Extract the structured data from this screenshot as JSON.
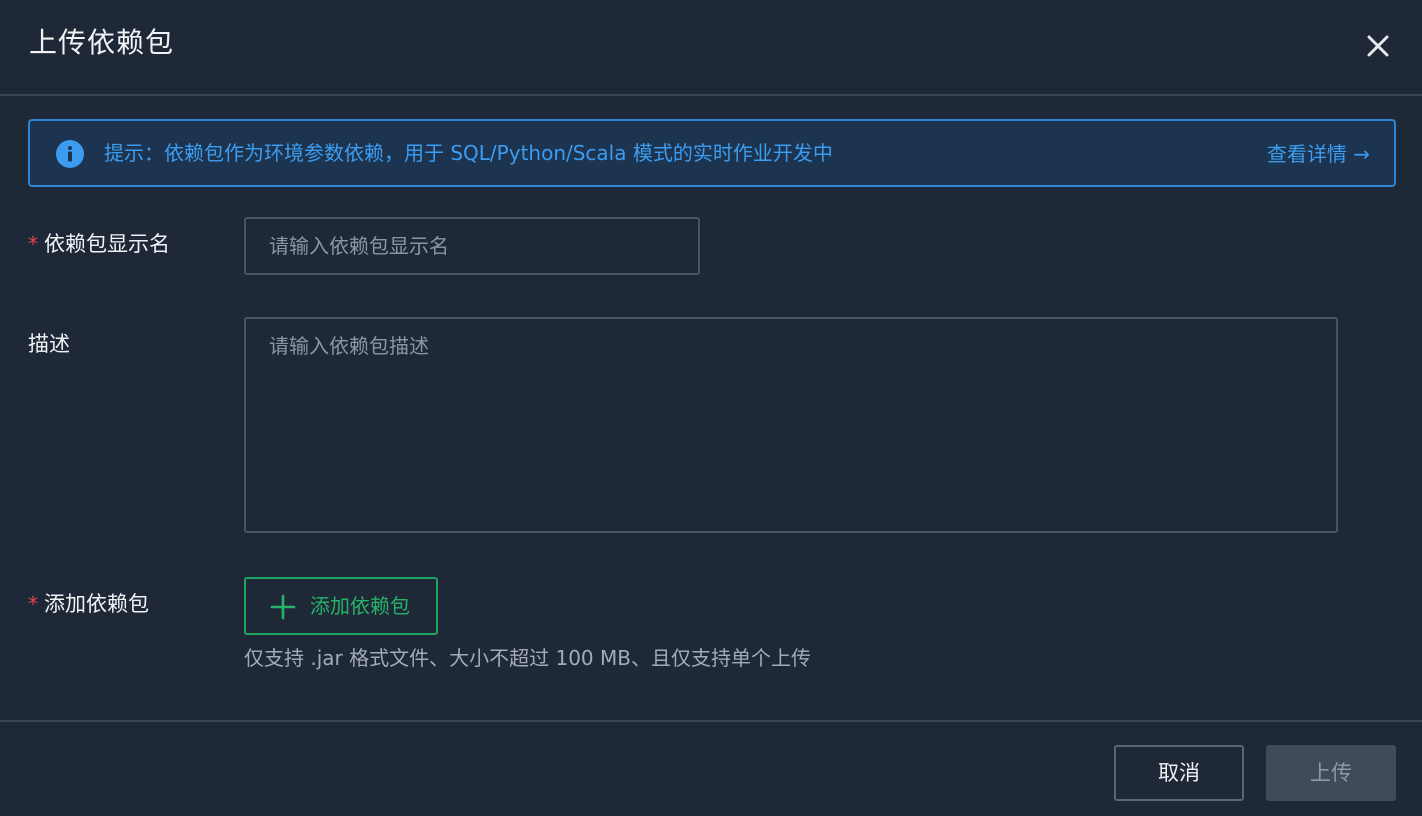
{
  "dialog": {
    "title": "上传依赖包",
    "close_icon": "close-icon"
  },
  "notice": {
    "icon": "info-icon",
    "text": "提示：依赖包作为环境参数依赖，用于 SQL/Python/Scala 模式的实时作业开发中",
    "link_label": "查看详情 →",
    "color": "#3c9cf0"
  },
  "form": {
    "display_name": {
      "required_mark": "*",
      "label": "依赖包显示名",
      "placeholder": "请输入依赖包显示名"
    },
    "description": {
      "label": "描述",
      "placeholder": "请输入依赖包描述"
    },
    "package": {
      "required_mark": "*",
      "label": "添加依赖包",
      "button_label": "添加依赖包",
      "button_icon": "plus-icon",
      "hint": "仅支持 .jar 格式文件、大小不超过 100 MB、且仅支持单个上传"
    }
  },
  "footer": {
    "cancel_label": "取消",
    "submit_label": "上传"
  },
  "colors": {
    "background": "#1e2836",
    "accent_green": "#25b36a",
    "required_red": "#e5484d"
  }
}
